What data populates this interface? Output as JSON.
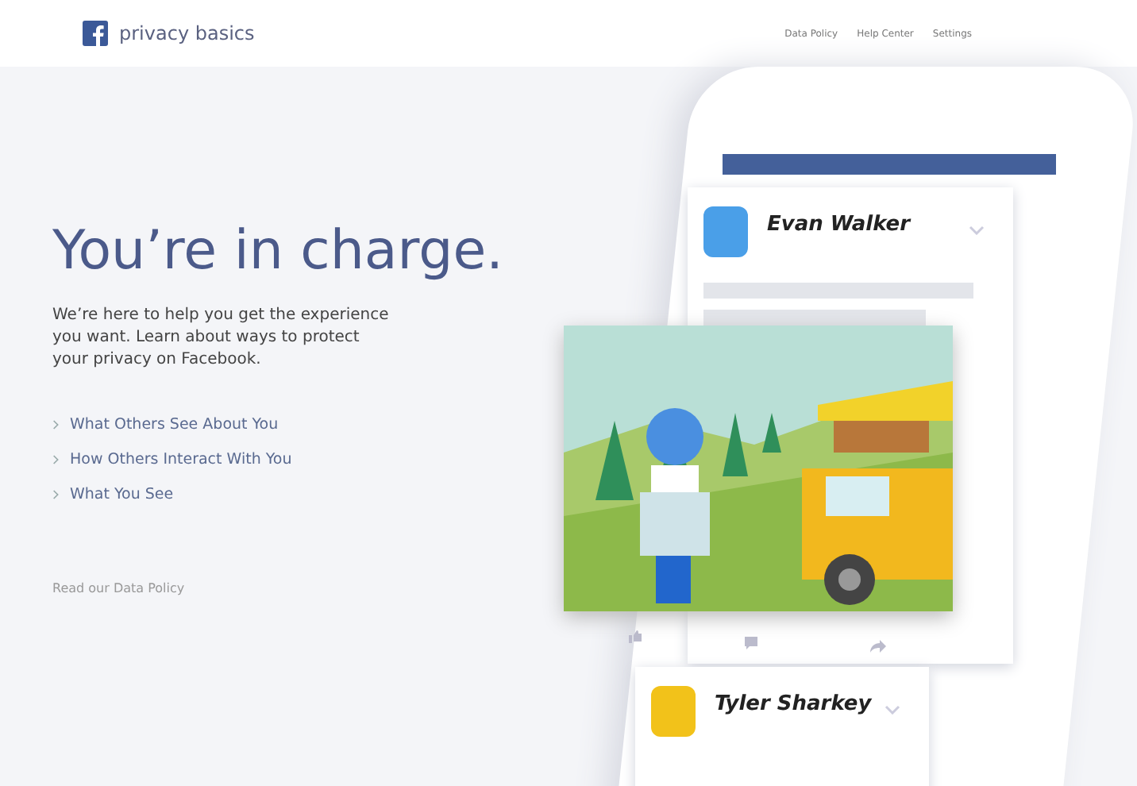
{
  "header": {
    "brand": "privacy basics",
    "nav": [
      "Data Policy",
      "Help Center",
      "Settings"
    ]
  },
  "hero": {
    "title": "You’re in charge.",
    "body": "We’re here to help you get the experience you want. Learn about ways to protect your privacy on Facebook.",
    "links": [
      "What Others See About You",
      "How Others Interact With You",
      "What You See"
    ],
    "footer_link": "Read our Data Policy"
  },
  "phone": {
    "posts": [
      {
        "name": "Evan Walker"
      },
      {
        "name": "Tyler Sharkey"
      }
    ]
  }
}
